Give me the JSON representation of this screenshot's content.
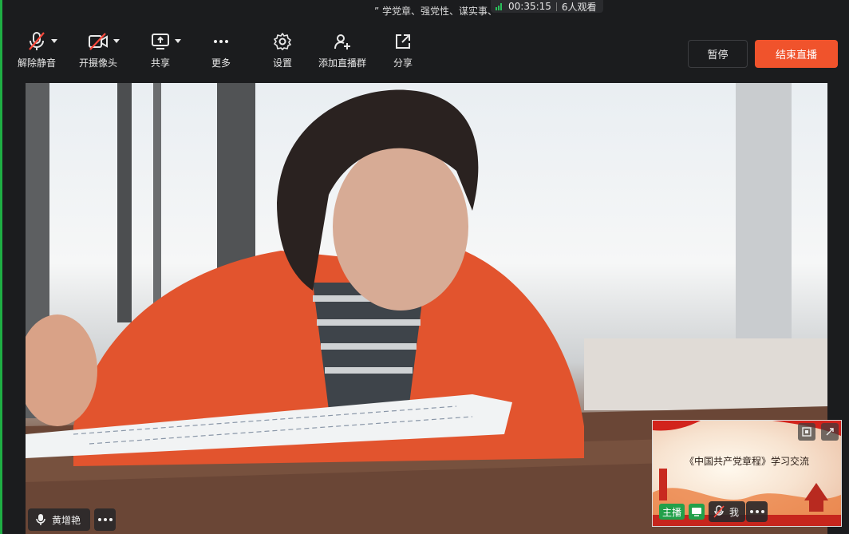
{
  "topbar": {
    "title": "” 学党章、强党性、谋实事、",
    "timer": "00:35:15",
    "viewers": "6人观看"
  },
  "toolbar": {
    "unmute_label": "解除静音",
    "camera_label": "开摄像头",
    "share_label": "共享",
    "more_label": "更多",
    "settings_label": "设置",
    "add_group_label": "添加直播群",
    "forward_label": "分享",
    "pause_label": "暂停",
    "end_label": "结束直播"
  },
  "video": {
    "presenter_name": "黄增艳"
  },
  "pip": {
    "slide_title": "《中国共产党章程》学习交流",
    "host_badge": "主播",
    "me_label": "我"
  },
  "colors": {
    "end_button": "#f0532c",
    "active_green": "#22a04a",
    "background": "#1b1c1e"
  }
}
